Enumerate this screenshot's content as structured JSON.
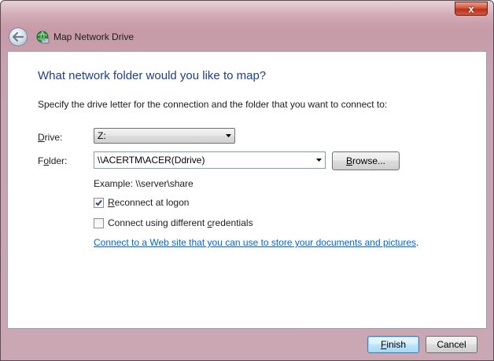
{
  "window": {
    "title": "Map Network Drive",
    "close_label": "x"
  },
  "main": {
    "heading": "What network folder would you like to map?",
    "instruction": "Specify the drive letter for the connection and the folder that you want to connect to:",
    "drive": {
      "label_first": "D",
      "label_rest": "rive:",
      "value": "Z:"
    },
    "folder": {
      "label_first": "F",
      "label_mid": "o",
      "label_rest": "lder:",
      "value": "\\\\ACERTM\\ACER(Ddrive)",
      "browse_label_prefix": "B",
      "browse_label_rest": "rowse..."
    },
    "example": "Example: \\\\server\\share",
    "reconnect": {
      "first": "R",
      "rest": "econnect at logon",
      "checked": true
    },
    "credentials": {
      "prefix": "Connect using different ",
      "underlined": "c",
      "rest": "redentials",
      "checked": false
    },
    "web_link": {
      "text": "Connect to a Web site that you can use to store your documents and pictures",
      "suffix": "."
    }
  },
  "footer": {
    "finish_first": "F",
    "finish_rest": "inish",
    "cancel_label": "Cancel"
  },
  "colors": {
    "heading": "#1e3f8b",
    "link": "#0066cc",
    "frame": "#c9a7b3"
  }
}
